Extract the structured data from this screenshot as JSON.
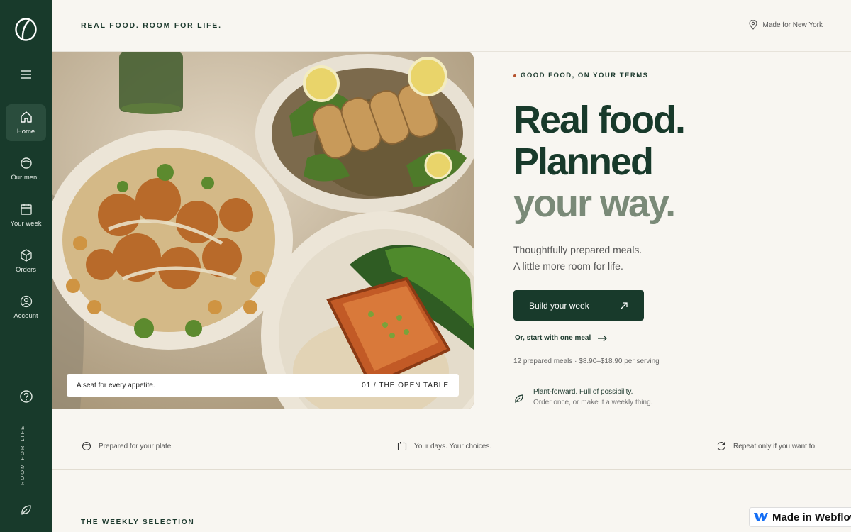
{
  "brand": {
    "tagline": "REAL FOOD. ROOM FOR LIFE.",
    "accent": "#183a2b",
    "accent_muted": "#7a8a78"
  },
  "location": {
    "label": "Made for New York",
    "icon": "map-pin-icon"
  },
  "sidebar": {
    "items": [
      {
        "label": "Home",
        "icon": "home-icon",
        "active": true
      },
      {
        "label": "Our menu",
        "icon": "bowl-icon",
        "active": false
      },
      {
        "label": "Your week",
        "icon": "calendar-icon",
        "active": false
      },
      {
        "label": "Orders",
        "icon": "box-icon",
        "active": false
      },
      {
        "label": "Account",
        "icon": "user-icon",
        "active": false
      }
    ],
    "vertical_text": "ROOM FOR LIFE"
  },
  "hero": {
    "caption_left": "A seat for every appetite.",
    "caption_right": "01 / THE OPEN TABLE"
  },
  "intro": {
    "eyebrow": "GOOD FOOD, ON YOUR TERMS",
    "headline_line1": "Real food.",
    "headline_line2": "Planned",
    "headline_line3": "your way.",
    "sub_line1": "Thoughtfully prepared meals.",
    "sub_line2": "A little more room for life.",
    "cta_label": "Build your week",
    "secondary_label": "Or, start with one meal",
    "price_line": "12 prepared meals · $8.90–$18.90 per serving",
    "feature_title": "Plant-forward. Full of possibility.",
    "feature_sub": "Order once, or make it a weekly thing."
  },
  "benefits": [
    {
      "label": "Prepared for your plate",
      "icon": "bowl-icon"
    },
    {
      "label": "Your days. Your choices.",
      "icon": "calendar-icon"
    },
    {
      "label": "Repeat only if you want to",
      "icon": "refresh-icon"
    }
  ],
  "section": {
    "weekly_title": "THE WEEKLY SELECTION"
  },
  "badge": {
    "label": "Made in Webflow"
  }
}
